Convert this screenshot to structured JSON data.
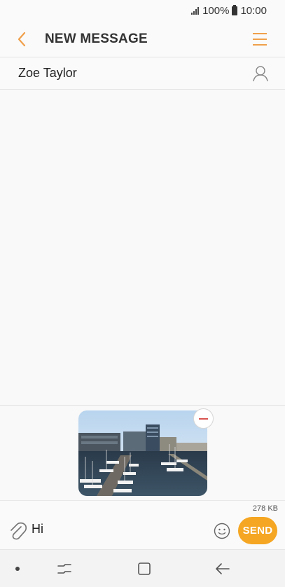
{
  "status_bar": {
    "signal_icon": "signal-icon",
    "battery_text": "100%",
    "battery_icon": "battery-icon",
    "time": "10:00"
  },
  "header": {
    "back_icon": "chevron-left-icon",
    "title": "NEW MESSAGE",
    "menu_icon": "menu-icon"
  },
  "recipient": {
    "name": "Zoe Taylor",
    "contact_icon": "person-icon"
  },
  "attachment": {
    "image_icon": "image-thumbnail",
    "remove_icon": "minus-icon"
  },
  "compose": {
    "size": "278 KB",
    "attach_icon": "paperclip-icon",
    "message": "Hi",
    "emoji_icon": "smiley-icon",
    "send_label": "SEND"
  },
  "nav": {
    "dot_icon": "dot-icon",
    "recent_icon": "recent-apps-icon",
    "home_icon": "home-icon",
    "back_icon": "back-arrow-icon"
  },
  "colors": {
    "accent": "#f0a04b",
    "send_bg": "#f5a623",
    "remove": "#d9534f"
  }
}
